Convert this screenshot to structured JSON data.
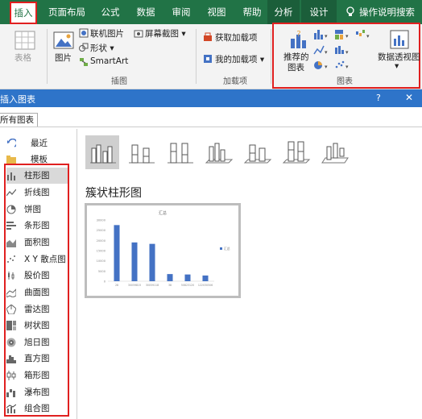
{
  "tabs": [
    "插入",
    "页面布局",
    "公式",
    "数据",
    "审阅",
    "视图",
    "帮助",
    "分析",
    "设计",
    "操作说明搜索"
  ],
  "ribbon": {
    "table_label": "表格",
    "picture_label": "图片",
    "online_picture": "联机图片",
    "shapes": "形状",
    "smartart": "SmartArt",
    "screenshot": "屏幕截图",
    "illustrations_group": "插图",
    "get_addins": "获取加载项",
    "my_addins": "我的加载项",
    "addins_group": "加载项",
    "recommended_charts_line1": "推荐的",
    "recommended_charts_line2": "图表",
    "pivot_chart": "数据透视图",
    "charts_group": "图表"
  },
  "dialog": {
    "title": "插入图表",
    "help": "?",
    "close": "✕",
    "tab": "所有图表",
    "selected_type_title": "簇状柱形图"
  },
  "nav": [
    "最近",
    "模板",
    "柱形图",
    "折线图",
    "饼图",
    "条形图",
    "面积图",
    "X Y 散点图",
    "股价图",
    "曲面图",
    "雷达图",
    "树状图",
    "旭日图",
    "直方图",
    "箱形图",
    "瀑布图",
    "组合图"
  ],
  "colors": {
    "excel_green": "#217346",
    "highlight_red": "#e02020",
    "dialog_blue": "#2e74c9",
    "bar_blue": "#4472c4"
  },
  "chart_data": {
    "type": "bar",
    "title": "汇总",
    "categories": [
      "28",
      "30059815",
      "30059118",
      "38",
      "50823120",
      "122030506"
    ],
    "values": [
      27500,
      19000,
      18300,
      3500,
      3300,
      2800
    ],
    "ylim": [
      0,
      30000
    ],
    "yticks": [
      "30000",
      "25000",
      "20000",
      "15000",
      "10000",
      "5000",
      "0"
    ],
    "legend": "汇总",
    "legend_position": "right",
    "grid": false
  }
}
